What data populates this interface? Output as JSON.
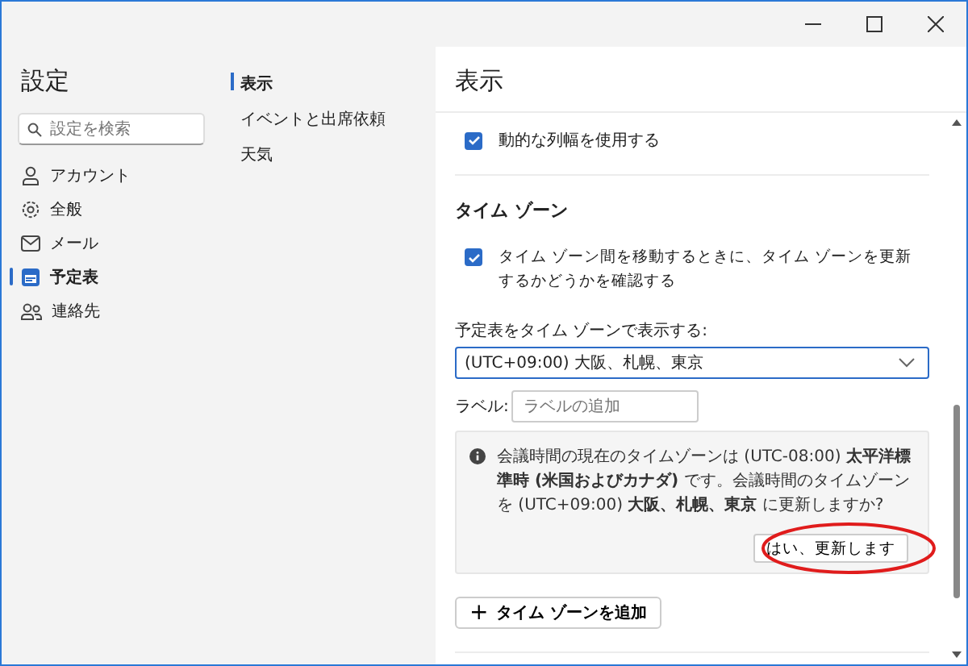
{
  "window": {
    "controls": [
      {
        "kind": "minimize"
      },
      {
        "kind": "maximize"
      },
      {
        "kind": "close"
      }
    ]
  },
  "sidebar": {
    "title": "設定",
    "search": {
      "placeholder": "設定を検索"
    },
    "items": [
      {
        "label": "アカウント",
        "selected": false
      },
      {
        "label": "全般",
        "selected": false
      },
      {
        "label": "メール",
        "selected": false
      },
      {
        "label": "予定表",
        "selected": true
      },
      {
        "label": "連絡先",
        "selected": false
      }
    ]
  },
  "subnav": {
    "items": [
      {
        "label": "表示",
        "selected": true
      },
      {
        "label": "イベントと出席依頼",
        "selected": false
      },
      {
        "label": "天気",
        "selected": false
      }
    ]
  },
  "content": {
    "title": "表示",
    "dynamic_width": {
      "label": "動的な列幅を使用する",
      "checked": true
    },
    "section_title": "タイム ゾーン",
    "ask_update": {
      "label": "タイム ゾーン間を移動するときに、タイム ゾーンを更新するかどうかを確認する",
      "checked": true
    },
    "display_label": "予定表をタイム ゾーンで表示する:",
    "timezone_select": {
      "value": "(UTC+09:00) 大阪、札幌、東京"
    },
    "label_field": {
      "label": "ラベル:",
      "placeholder": "ラベルの追加"
    },
    "notice": {
      "text": "会議時間の現在のタイムゾーンは (UTC-08:00) **太平洋標準時 (米国およびカナダ)** です。会議時間のタイムゾーンを (UTC+09:00) **大阪、札幌、東京** に更新しますか?",
      "button": "はい、更新します",
      "highlighted": true
    },
    "add_button": {
      "icon": "+",
      "label": "タイム ゾーンを追加"
    }
  }
}
